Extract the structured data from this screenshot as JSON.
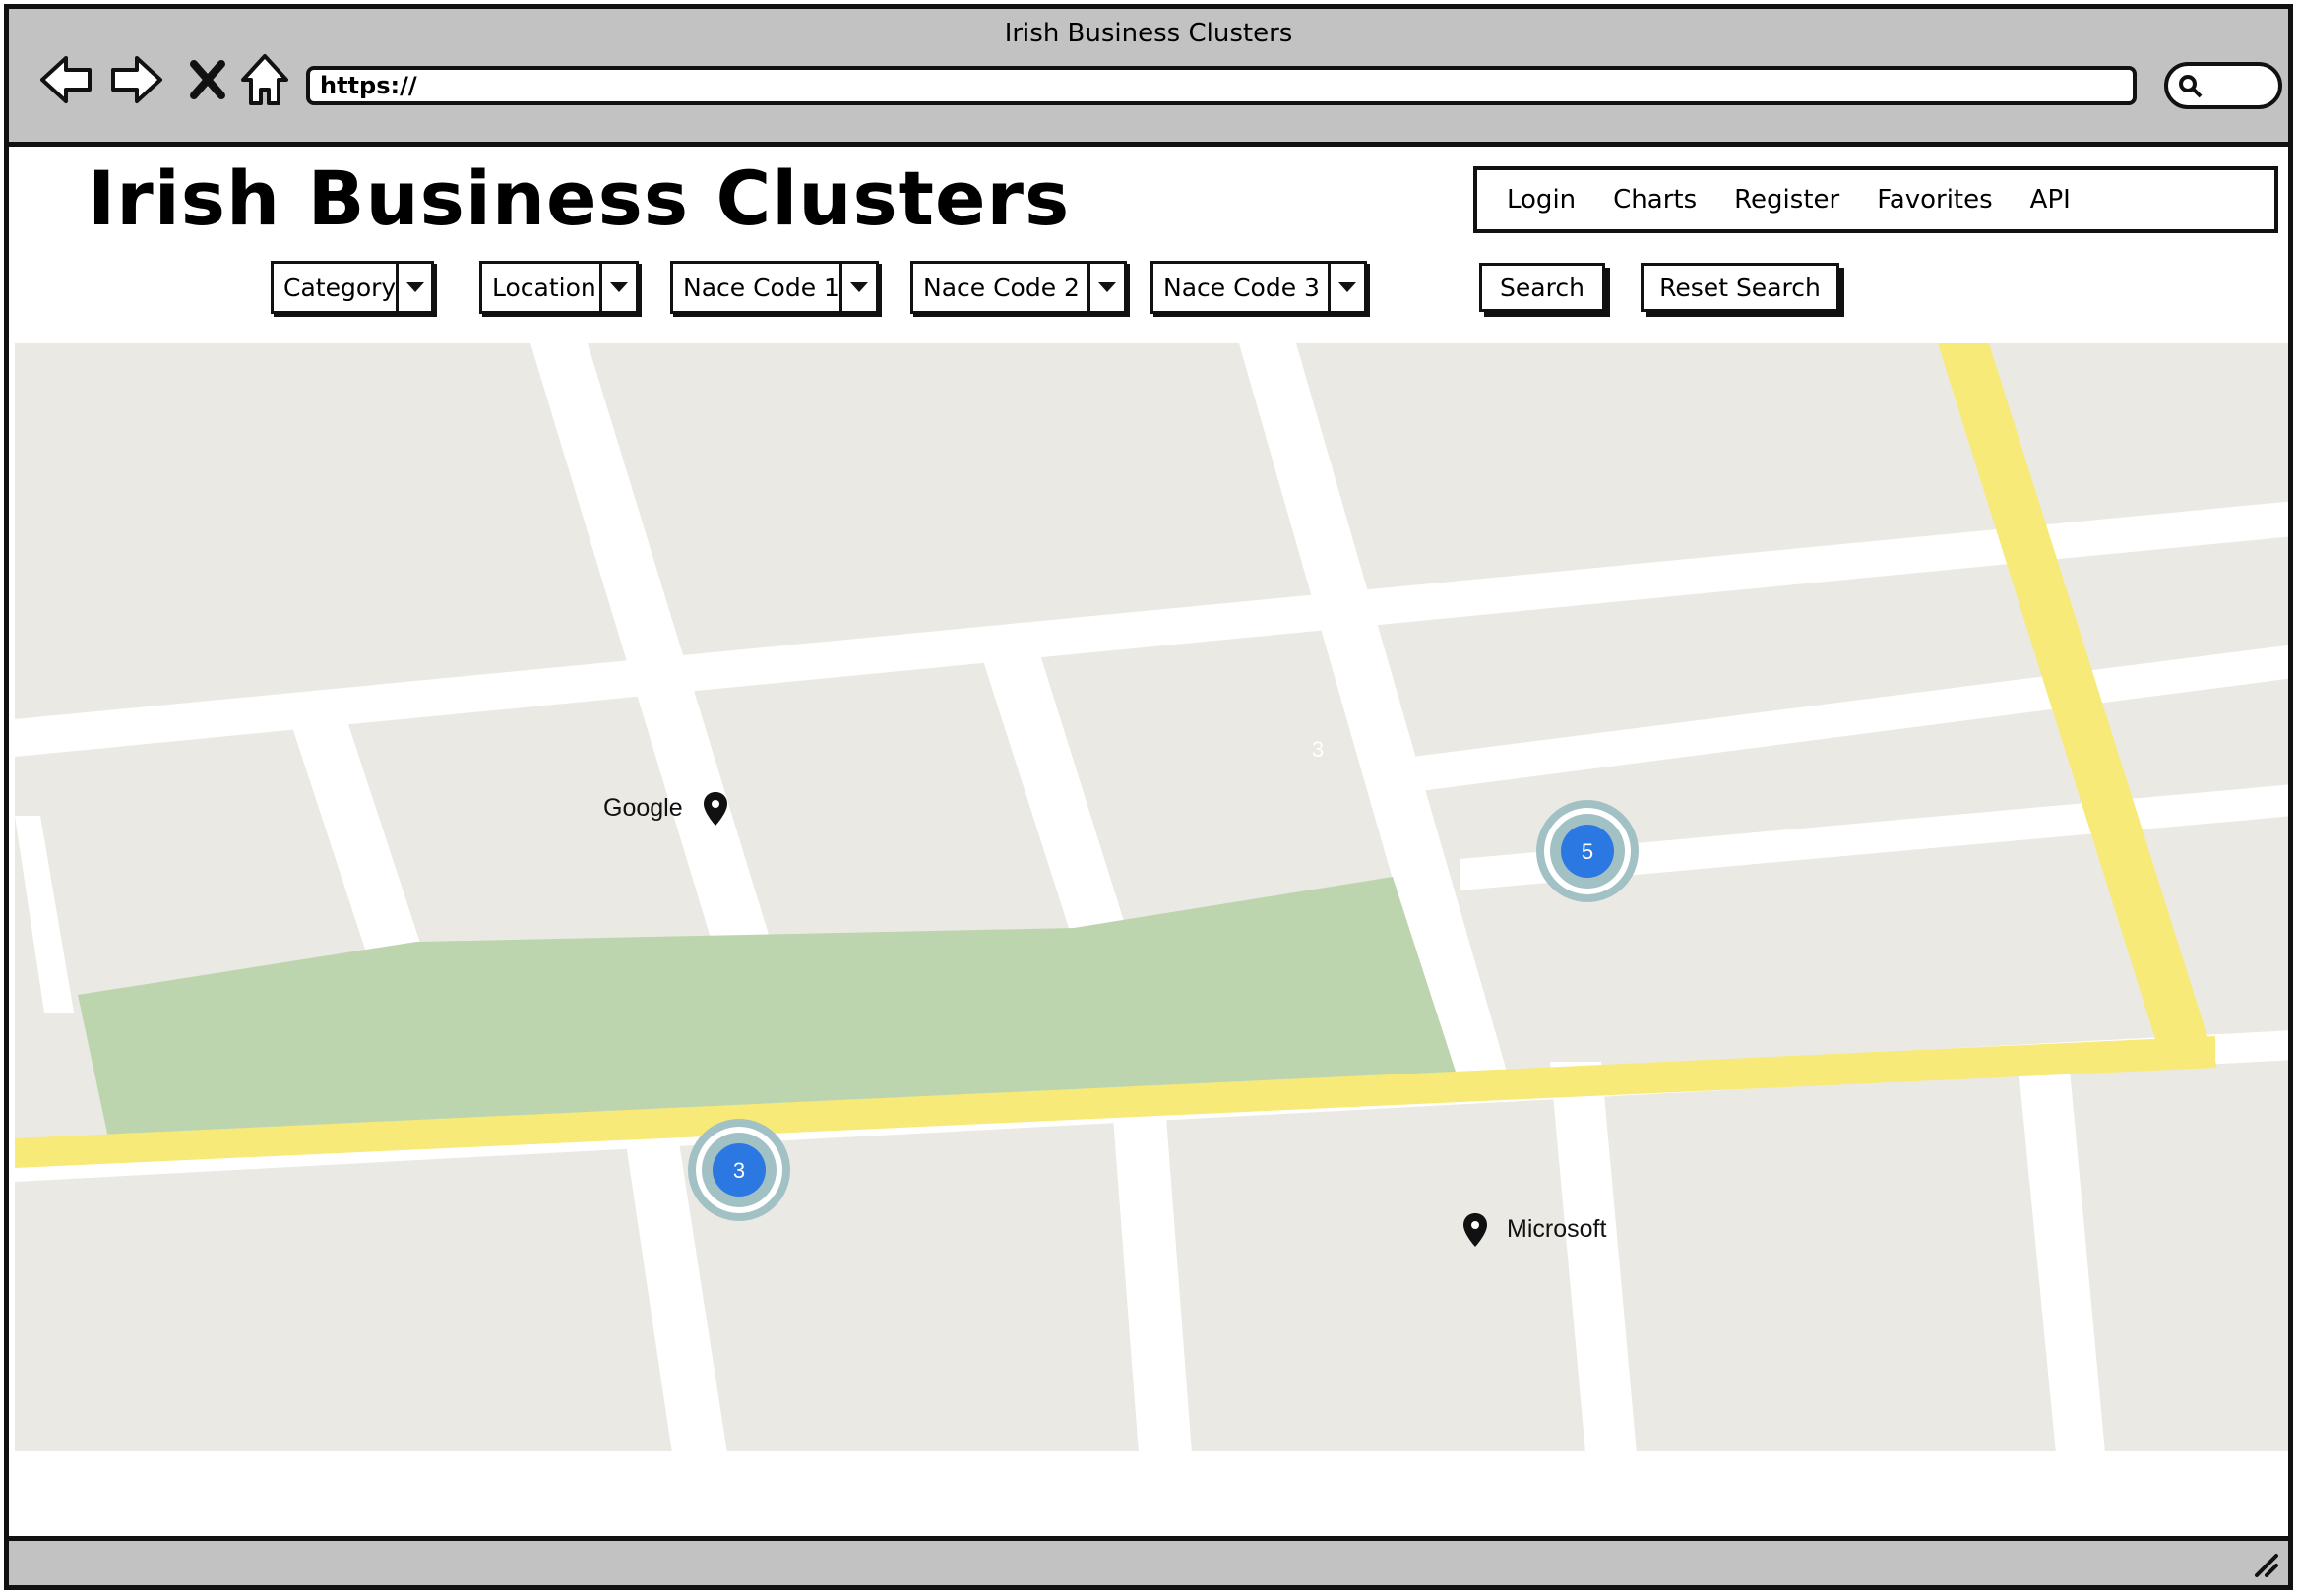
{
  "browser": {
    "window_title": "Irish Business Clusters",
    "url": "https://",
    "icons": [
      "back-arrow-icon",
      "forward-arrow-icon",
      "close-x-icon",
      "home-icon",
      "search-icon"
    ]
  },
  "header": {
    "title": "Irish Business Clusters",
    "nav": [
      "Login",
      "Charts",
      "Register",
      "Favorites",
      "API"
    ]
  },
  "filters": {
    "dropdowns": [
      "Category",
      "Location",
      "Nace Code 1",
      "Nace Code 2",
      "Nace Code 3"
    ],
    "search_label": "Search",
    "reset_label": "Reset Search"
  },
  "map": {
    "markers": [
      {
        "label": "Google",
        "icon": "map-pin-icon"
      },
      {
        "label": "Microsoft",
        "icon": "map-pin-icon"
      }
    ],
    "clusters": [
      {
        "count": "5"
      },
      {
        "count": "3"
      }
    ],
    "faint_label": "3",
    "colors": {
      "block": "#ebe9e3",
      "road": "#ffffff",
      "highway": "#f7ea79",
      "park": "#bdd5ae",
      "cluster": "#2c78e2",
      "cluster_ring": "#a2c1c5"
    }
  }
}
